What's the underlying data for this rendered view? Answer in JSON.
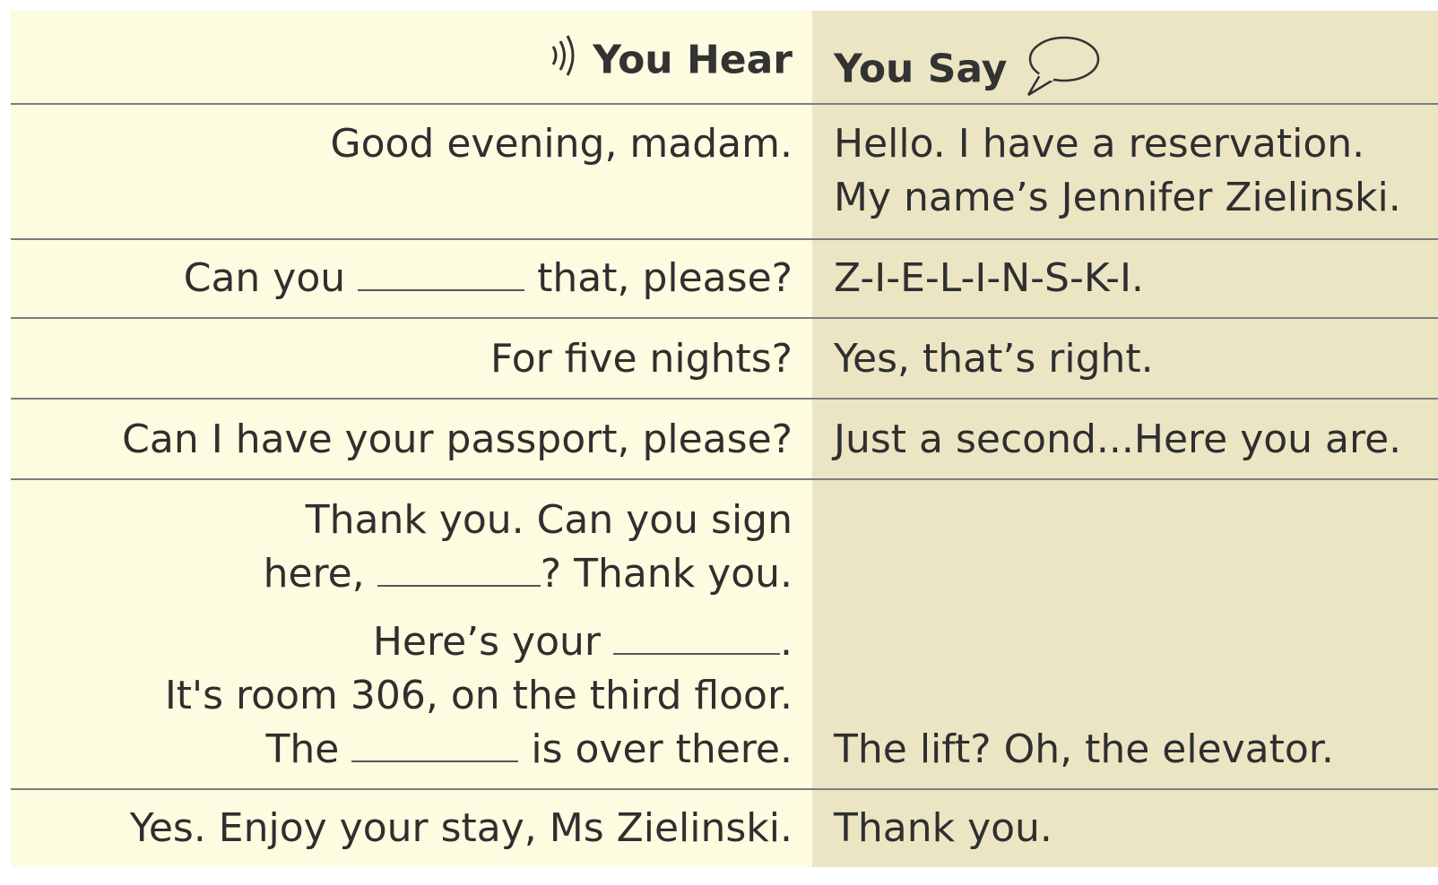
{
  "header": {
    "you_hear": "You Hear",
    "you_say": "You Say",
    "hear_icon": "sound-waves-icon",
    "say_icon": "speech-bubble-icon"
  },
  "rows": [
    {
      "hear_lines": [
        "Good evening, madam."
      ],
      "say_lines": [
        "Hello. I have a reservation.",
        "My name’s Jennifer Zielinski."
      ]
    },
    {
      "hear_parts": [
        "Can you",
        "that, please?"
      ],
      "say_lines": [
        "Z-I-E-L-I-N-S-K-I."
      ]
    },
    {
      "hear_lines": [
        "For five nights?"
      ],
      "say_lines": [
        "Yes, that’s right."
      ]
    },
    {
      "hear_lines": [
        "Can I have your passport, please?"
      ],
      "say_lines": [
        "Just a second...Here you are."
      ]
    },
    {
      "hear_a1": "Thank you. Can you sign",
      "hear_a2_before": "here,",
      "hear_a2_after": "? Thank you.",
      "hear_b1_before": "Here’s your",
      "hear_b1_after": ".",
      "hear_b2": "It's room 306, on the third floor.",
      "hear_b3_before": "The",
      "hear_b3_after": "is over there.",
      "say_lines": [
        "The lift? Oh, the elevator."
      ]
    },
    {
      "hear_lines": [
        "Yes. Enjoy your stay, Ms Zielinski."
      ],
      "say_lines": [
        "Thank you."
      ]
    }
  ]
}
